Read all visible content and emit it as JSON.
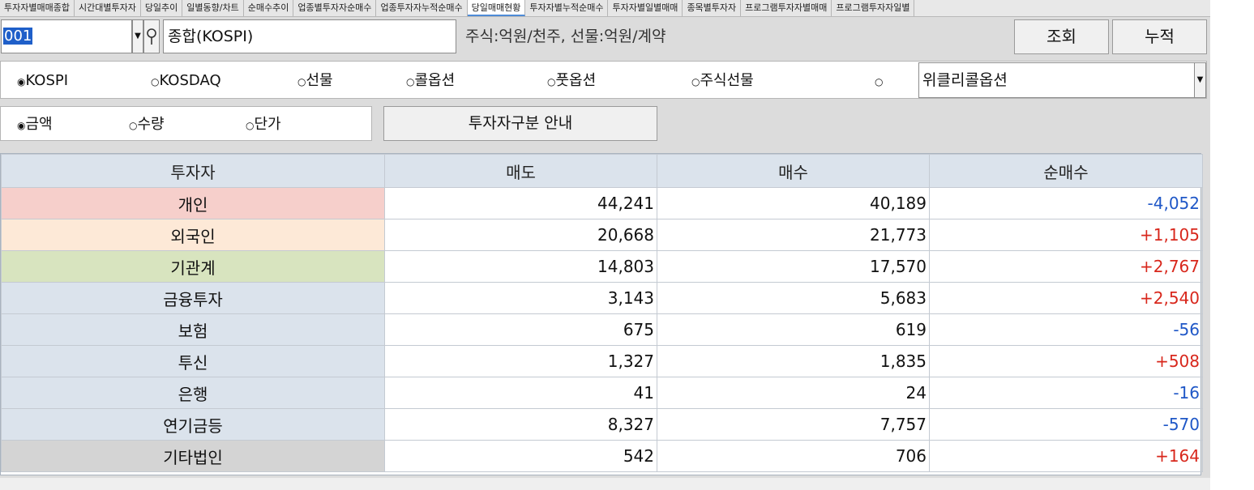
{
  "tabs": [
    "투자자별매매종합",
    "시간대별투자자",
    "당일추이",
    "일별동향/차트",
    "순매수추이",
    "업종별투자자순매수",
    "업종투자자누적순매수",
    "당일매매현황",
    "투자자별누적순매수",
    "투자자별일별매매",
    "종목별투자자",
    "프로그램투자자별매매",
    "프로그램투자자일별"
  ],
  "active_tab_index": 7,
  "code": {
    "value": "001",
    "name": "종합(KOSPI)"
  },
  "unit_label": "주식:억원/천주, 선물:억원/계약",
  "buttons": {
    "query": "조회",
    "cumulative": "누적",
    "guide": "투자자구분 안내"
  },
  "market_options": [
    {
      "label": "KOSPI",
      "selected": true
    },
    {
      "label": "KOSDAQ",
      "selected": false
    },
    {
      "label": "선물",
      "selected": false
    },
    {
      "label": "콜옵션",
      "selected": false
    },
    {
      "label": "풋옵션",
      "selected": false
    },
    {
      "label": "주식선물",
      "selected": false
    },
    {
      "label": "",
      "selected": false
    }
  ],
  "weekly_select": {
    "value": "위클리콜옵션"
  },
  "value_type_options": [
    {
      "label": "금액",
      "selected": true
    },
    {
      "label": "수량",
      "selected": false
    },
    {
      "label": "단가",
      "selected": false
    }
  ],
  "colors": {
    "positive": "#d8271c",
    "negative": "#1f57c7",
    "individual": "#f6cfcb",
    "foreign": "#fde9d7",
    "institution": "#d8e4bf",
    "sub": "#dbe3ec",
    "other": "#d4d4d4"
  },
  "table": {
    "headers": [
      "투자자",
      "매도",
      "매수",
      "순매수"
    ],
    "rows": [
      {
        "investor": "개인",
        "sell": "44,241",
        "buy": "40,189",
        "net": "-4,052",
        "color": "#f6cfcb",
        "sign": "neg"
      },
      {
        "investor": "외국인",
        "sell": "20,668",
        "buy": "21,773",
        "net": "+1,105",
        "color": "#fde9d7",
        "sign": "pos"
      },
      {
        "investor": "기관계",
        "sell": "14,803",
        "buy": "17,570",
        "net": "+2,767",
        "color": "#d8e4bf",
        "sign": "pos"
      },
      {
        "investor": "금융투자",
        "sell": "3,143",
        "buy": "5,683",
        "net": "+2,540",
        "color": "#dbe3ec",
        "sign": "pos"
      },
      {
        "investor": "보험",
        "sell": "675",
        "buy": "619",
        "net": "-56",
        "color": "#dbe3ec",
        "sign": "neg"
      },
      {
        "investor": "투신",
        "sell": "1,327",
        "buy": "1,835",
        "net": "+508",
        "color": "#dbe3ec",
        "sign": "pos"
      },
      {
        "investor": "은행",
        "sell": "41",
        "buy": "24",
        "net": "-16",
        "color": "#dbe3ec",
        "sign": "neg"
      },
      {
        "investor": "연기금등",
        "sell": "8,327",
        "buy": "7,757",
        "net": "-570",
        "color": "#dbe3ec",
        "sign": "neg"
      },
      {
        "investor": "기타법인",
        "sell": "542",
        "buy": "706",
        "net": "+164",
        "color": "#d4d4d4",
        "sign": "pos"
      }
    ]
  }
}
